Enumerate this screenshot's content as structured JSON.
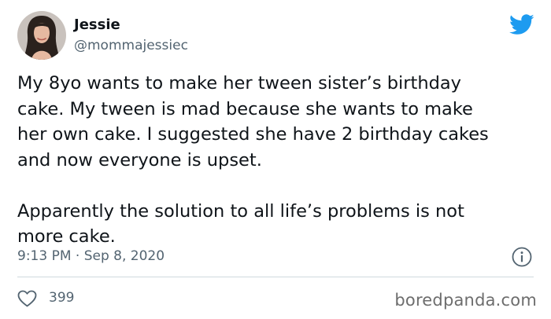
{
  "author": {
    "display_name": "Jessie",
    "handle": "@mommajessiec",
    "avatar_icon": "user-photo"
  },
  "tweet": {
    "paragraphs": [
      "My 8yo wants to make her tween sister’s birthday\ncake. My tween is mad because she wants to make\nher own cake. I suggested she have 2 birthday cakes\nand now everyone is upset.",
      "Apparently the solution to all life’s problems is not\nmore cake."
    ],
    "timestamp": "9:13 PM · Sep 8, 2020",
    "likes": "399"
  },
  "icons": {
    "brand": "twitter-bird-icon",
    "info": "info-icon",
    "like": "heart-icon"
  },
  "colors": {
    "twitter_blue": "#1d9bf0",
    "secondary_text": "#536471",
    "divider": "#cfd9de"
  },
  "watermark": "boredpanda.com"
}
